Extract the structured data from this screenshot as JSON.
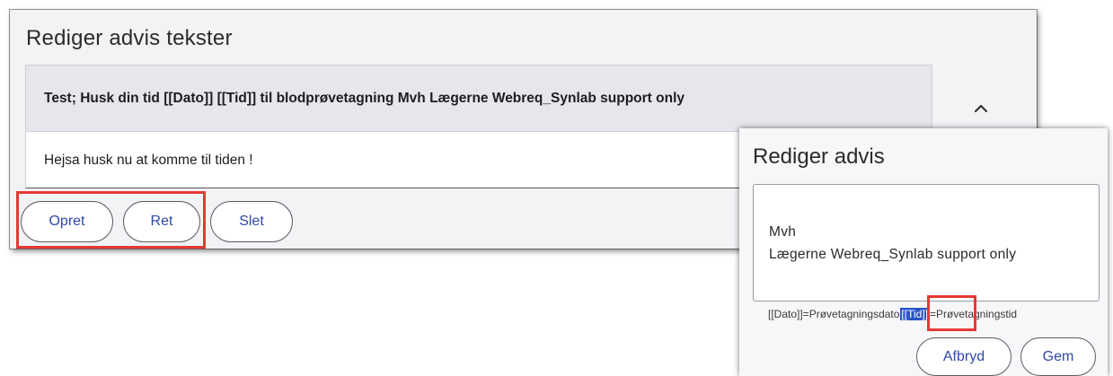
{
  "main": {
    "title": "Rediger advis tekster",
    "advis_header": "Test; Husk din tid [[Dato]] [[Tid]] til blodprøvetagning Mvh Lægerne Webreq_Synlab support only",
    "advis_body": "Hejsa husk nu at komme til tiden !",
    "collapse_icon": "chevron-up-icon",
    "buttons": {
      "opret": "Opret",
      "ret": "Ret",
      "slet": "Slet"
    }
  },
  "dialog": {
    "title": "Rediger advis",
    "text_lines": [
      "Mvh",
      "Lægerne Webreq_Synlab support only"
    ],
    "hint_before": "[[Dato]]=Prøvetagningsdato",
    "hint_selected": "[[Tid]]",
    "hint_after": "=Prøvetagningstid",
    "buttons": {
      "afbryd": "Afbryd",
      "gem": "Gem"
    }
  },
  "colors": {
    "highlight": "#e53935",
    "button_text": "#2e49a8",
    "selection": "#2a55c8"
  }
}
